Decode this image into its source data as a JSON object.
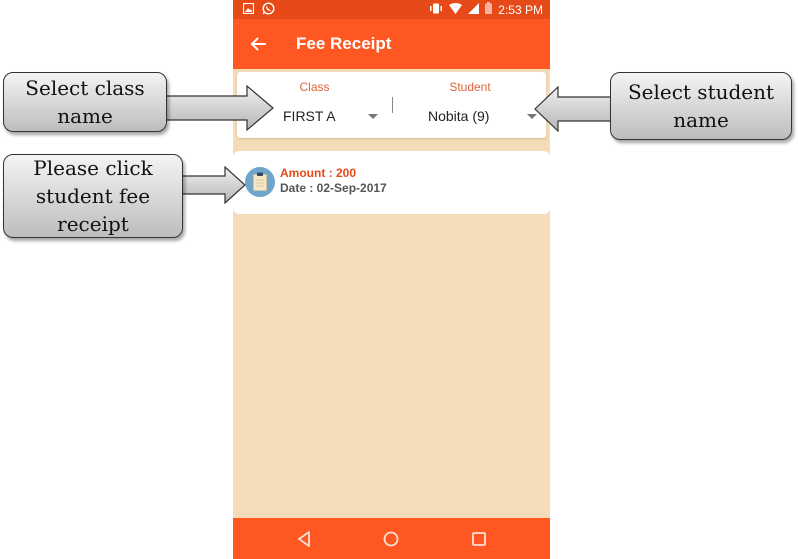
{
  "status_bar": {
    "time": "2:53 PM",
    "left_icons": [
      "gallery-icon",
      "whatsapp-icon"
    ],
    "right_icons": [
      "vibrate-icon",
      "wifi-icon",
      "signal-icon",
      "battery-icon"
    ]
  },
  "app_bar": {
    "back_icon": "arrow-left-icon",
    "title": "Fee Receipt"
  },
  "selectors": {
    "class": {
      "label": "Class",
      "value": "FIRST A"
    },
    "student": {
      "label": "Student",
      "value": "Nobita (9)"
    }
  },
  "receipts": [
    {
      "icon": "clipboard-icon",
      "amount": "Amount : 200",
      "date": "Date : 02-Sep-2017"
    }
  ],
  "nav_bar": {
    "buttons": [
      "back-triangle-icon",
      "home-circle-icon",
      "recent-square-icon"
    ]
  },
  "annotations": {
    "class_callout": "Select class name",
    "student_callout": "Select student name",
    "receipt_callout": "Please click student  fee receipt"
  },
  "colors": {
    "status_bar": "#e64a19",
    "app_bar": "#ff5722",
    "background": "#f5dcb8",
    "label_accent": "#e0643c"
  }
}
